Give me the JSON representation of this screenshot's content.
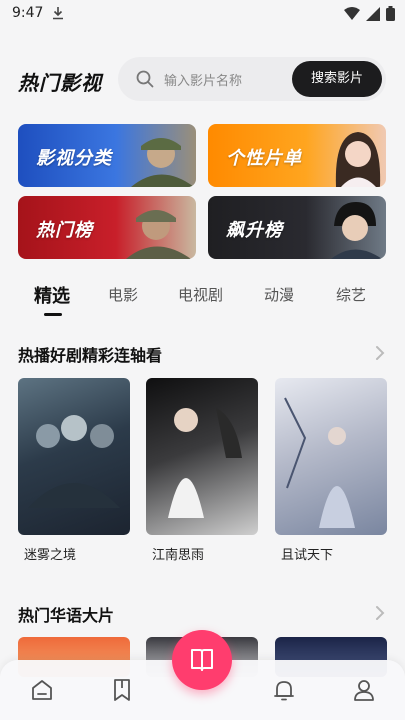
{
  "status_bar": {
    "time": "9:47"
  },
  "header": {
    "title": "热门影视",
    "search_placeholder": "输入影片名称",
    "search_button": "搜索影片"
  },
  "categories": [
    {
      "label": "影视分类"
    },
    {
      "label": "个性片单"
    },
    {
      "label": "热门榜"
    },
    {
      "label": "飙升榜"
    }
  ],
  "tabs": [
    {
      "label": "精选",
      "active": true
    },
    {
      "label": "电影"
    },
    {
      "label": "电视剧"
    },
    {
      "label": "动漫"
    },
    {
      "label": "综艺"
    }
  ],
  "sections": [
    {
      "title": "热播好剧精彩连轴看",
      "items": [
        {
          "title": "迷雾之境"
        },
        {
          "title": "江南思雨"
        },
        {
          "title": "且试天下"
        }
      ]
    },
    {
      "title": "热门华语大片"
    }
  ],
  "colors": {
    "accent": "#ff3d6e",
    "search_button_bg": "#1c1c1e"
  },
  "bottom_nav": {
    "icons": [
      "home-icon",
      "bookmark-icon",
      "reader-icon",
      "bell-icon",
      "user-icon"
    ]
  }
}
